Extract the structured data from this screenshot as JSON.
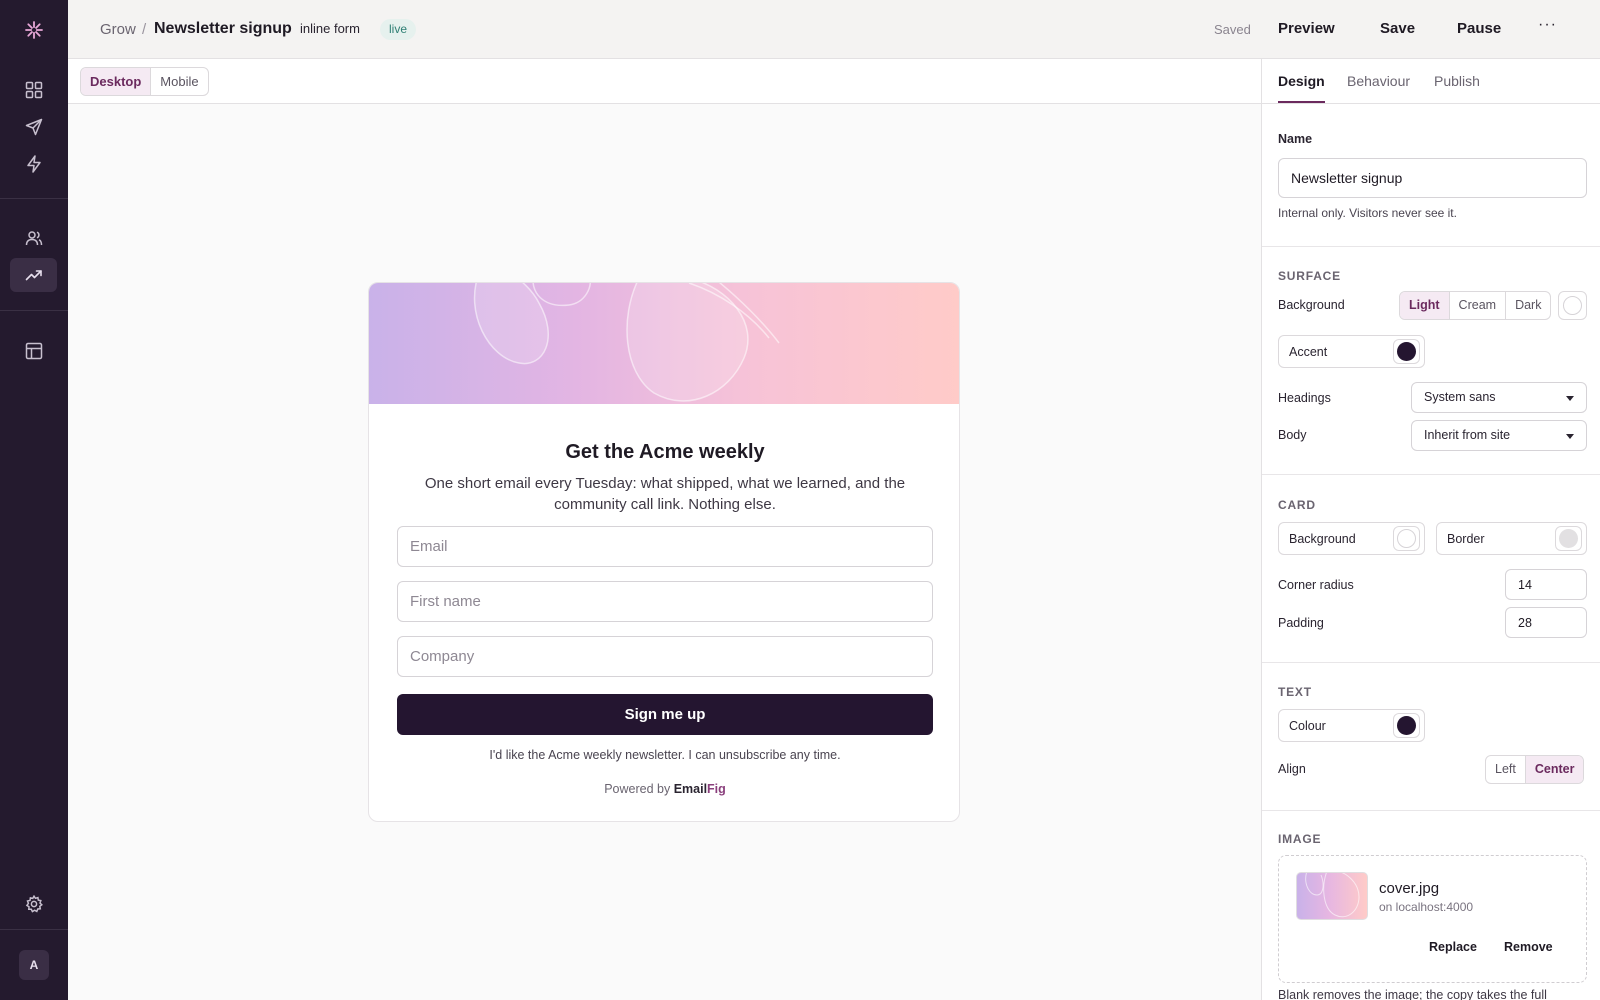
{
  "breadcrumb": {
    "root": "Grow",
    "separator": "/",
    "title": "Newsletter signup"
  },
  "form_type": "inline form",
  "status": "live",
  "save_state": "Saved",
  "toolbar": {
    "preview": "Preview",
    "save": "Save",
    "pause": "Pause",
    "more": "···"
  },
  "device_toggle": {
    "options": [
      "Desktop",
      "Mobile"
    ],
    "selected": "Desktop"
  },
  "form_preview": {
    "title": "Get the Acme weekly",
    "subtitle": "One short email every Tuesday: what shipped, what we learned, and the community call link. Nothing else.",
    "fields": [
      {
        "placeholder": "Email"
      },
      {
        "placeholder": "First name"
      },
      {
        "placeholder": "Company"
      }
    ],
    "cta": "Sign me up",
    "consent": "I'd like the Acme weekly newsletter. I can unsubscribe any time.",
    "powered_prefix": "Powered by",
    "brand_a": "Email",
    "brand_b": "Fig"
  },
  "panel": {
    "tabs": [
      "Design",
      "Behaviour",
      "Publish"
    ],
    "active_tab": "Design",
    "name_label": "Name",
    "name_value": "Newsletter signup",
    "name_hint": "Internal only. Visitors never see it.",
    "surface": {
      "heading": "SURFACE",
      "background_label": "Background",
      "background_options": [
        "Light",
        "Cream",
        "Dark"
      ],
      "background_selected": "Light",
      "accent_label": "Accent",
      "accent_color": "#241530",
      "headings_label": "Headings",
      "headings_value": "System sans",
      "body_label": "Body",
      "body_value": "Inherit from site"
    },
    "card": {
      "heading": "CARD",
      "background_label": "Background",
      "background_color": "#ffffff",
      "border_label": "Border",
      "border_color": "#e2e0e2",
      "radius_label": "Corner radius",
      "radius_value": "14",
      "padding_label": "Padding",
      "padding_value": "28"
    },
    "text": {
      "heading": "TEXT",
      "colour_label": "Colour",
      "colour_value": "#241530",
      "align_label": "Align",
      "align_options": [
        "Left",
        "Center"
      ],
      "align_selected": "Center"
    },
    "image": {
      "heading": "IMAGE",
      "filename": "cover.jpg",
      "source": "on localhost:4000",
      "replace": "Replace",
      "remove": "Remove",
      "footnote": "Blank removes the image; the copy takes the full"
    }
  },
  "user_avatar": "A",
  "colors": {
    "rail": "#241a2e",
    "accent": "#6b2a5e",
    "cta": "#241530",
    "live": "#2f7f74"
  }
}
